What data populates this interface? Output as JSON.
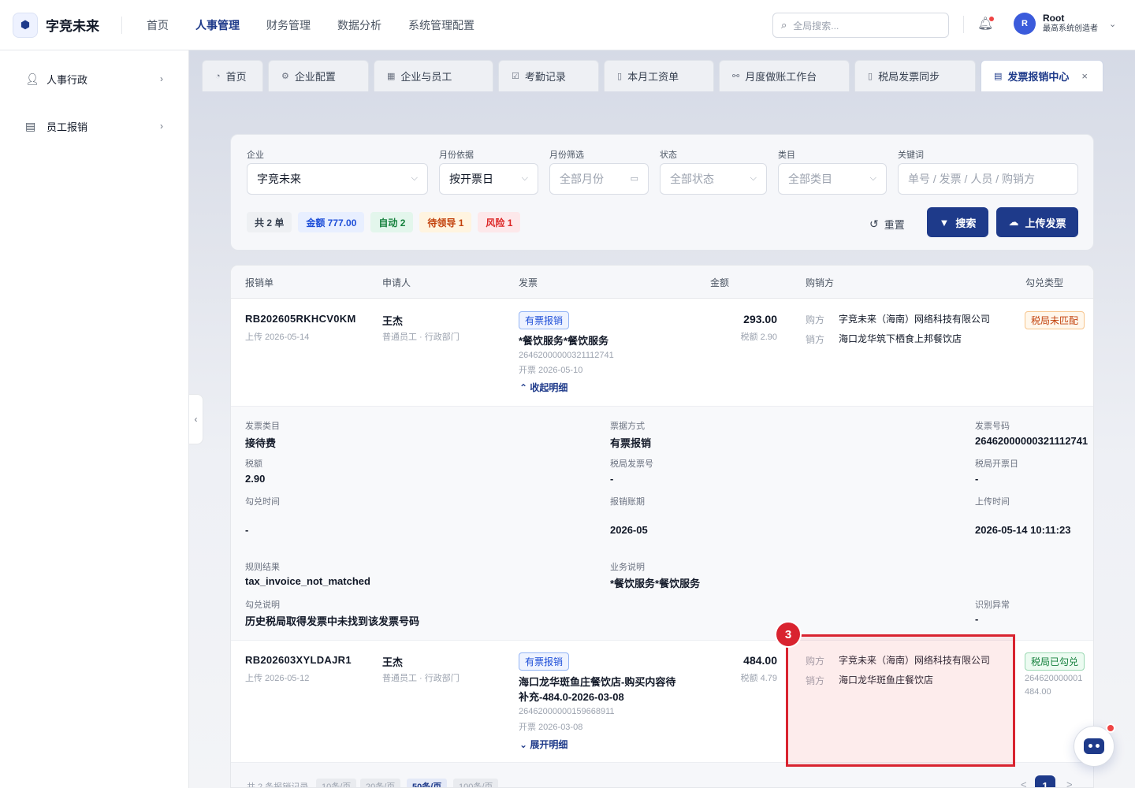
{
  "app": {
    "name": "字竞未来"
  },
  "topnav": [
    "首页",
    "人事管理",
    "财务管理",
    "数据分析",
    "系统管理配置"
  ],
  "search": {
    "placeholder": "全局搜索..."
  },
  "user": {
    "initial": "R",
    "name": "Root",
    "role": "最高系统创造者"
  },
  "sidebar": [
    {
      "label": "人事行政",
      "icon": "person-icon"
    },
    {
      "label": "员工报销",
      "icon": "document-icon"
    }
  ],
  "tabs": [
    "首页",
    "企业配置",
    "企业与员工",
    "考勤记录",
    "本月工资单",
    "月度做账工作台",
    "税局发票同步",
    "发票报销中心"
  ],
  "filters": {
    "company_label": "企业",
    "company_value": "字竞未来",
    "month_basis_label": "月份依据",
    "month_basis_value": "按开票日",
    "month_filter_label": "月份筛选",
    "month_filter_placeholder": "全部月份",
    "status_label": "状态",
    "status_placeholder": "全部状态",
    "category_label": "类目",
    "category_placeholder": "全部类目",
    "keyword_label": "关键词",
    "keyword_placeholder": "单号 / 发票 / 人员 / 购销方"
  },
  "summary": {
    "total": "共 2 单",
    "amount": "金额 777.00",
    "auto": "自动 2",
    "pending": "待领导 1",
    "risk": "风险 1"
  },
  "actions": {
    "reset": "重置",
    "search": "搜索",
    "upload": "上传发票"
  },
  "columns": [
    "报销单",
    "申请人",
    "发票",
    "金额",
    "购销方",
    "勾兑类型"
  ],
  "rows": [
    {
      "no": "RB202605RKHCV0KM",
      "uploaded": "上传 2026-05-14",
      "applicant": "王杰",
      "dept": "普通员工 · 行政部门",
      "invoice_tag": "有票报销",
      "invoice_title": "*餐饮服务*餐饮服务",
      "invoice_no": "26462000000321112741",
      "invoice_date": "开票 2026-05-10",
      "toggle": "收起明细",
      "amount": "293.00",
      "tax": "税额 2.90",
      "buyer_label": "购方",
      "buyer": "字竞未来（海南）网络科技有限公司",
      "seller_label": "销方",
      "seller": "海口龙华筑下栖食上邦餐饮店",
      "match_tag": "税局未匹配"
    },
    {
      "no": "RB202603XYLDAJR1",
      "uploaded": "上传 2026-05-12",
      "applicant": "王杰",
      "dept": "普通员工 · 行政部门",
      "invoice_tag": "有票报销",
      "invoice_title_1": "海口龙华斑鱼庄餐饮店-购买内容待",
      "invoice_title_2": "补充-484.0-2026-03-08",
      "invoice_no": "26462000000159668911",
      "invoice_date": "开票 2026-03-08",
      "toggle": "展开明细",
      "amount": "484.00",
      "tax": "税额 4.79",
      "buyer_label": "购方",
      "buyer": "字竞未来（海南）网络科技有限公司",
      "seller_label": "销方",
      "seller": "海口龙华斑鱼庄餐饮店",
      "match_tag": "税局已勾兑",
      "match_no": "264620000001",
      "match_amount": "484.00"
    }
  ],
  "detail": {
    "category_label": "发票类目",
    "category": "接待费",
    "method_label": "票据方式",
    "method": "有票报销",
    "invoice_no_label": "发票号码",
    "invoice_no": "26462000000321112741",
    "tax_label": "税额",
    "tax": "2.90",
    "tax_invoice_label": "税局发票号",
    "tax_invoice": "-",
    "tax_date_label": "税局开票日",
    "tax_date": "-",
    "match_time_label": "勾兑时间",
    "match_time": "-",
    "period_label": "报销账期",
    "period": "2026-05",
    "upload_time_label": "上传时间",
    "upload_time": "2026-05-14 10:11:23",
    "rule_label": "规则结果",
    "rule": "tax_invoice_not_matched",
    "biz_label": "业务说明",
    "biz": "*餐饮服务*餐饮服务",
    "match_note_label": "勾兑说明",
    "match_note": "历史税局取得发票中未找到该发票号码",
    "anomaly_label": "识别异常",
    "anomaly": "-"
  },
  "pager": {
    "total": "共 2 条报销记录",
    "sizes": [
      "10条/页",
      "20条/页",
      "50条/页",
      "100条/页"
    ],
    "page": "1",
    "prev": "<",
    "next": ">"
  },
  "annotation": {
    "badge": "3"
  },
  "colors": {
    "primary": "#1e3a8a",
    "highlight": "#d9232f"
  }
}
